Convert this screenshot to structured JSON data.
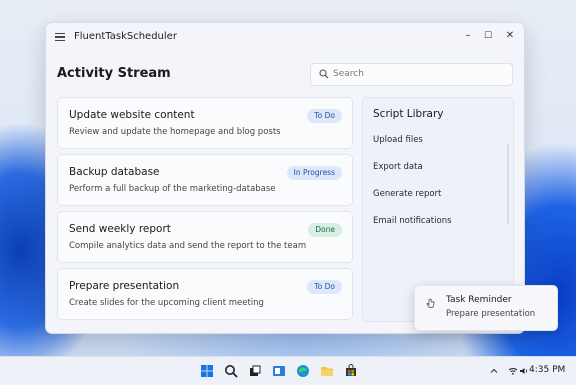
{
  "window": {
    "title": "FluentTaskScheduler",
    "controls": {
      "minimize": "–",
      "maximize": "☐",
      "close": "✕"
    }
  },
  "page": {
    "title": "Activity Stream"
  },
  "search": {
    "placeholder": "Search",
    "value": ""
  },
  "tasks": [
    {
      "title": "Update website content",
      "description": "Review and update the homepage and blog posts",
      "status": "To Do"
    },
    {
      "title": "Backup database",
      "description": "Perform a full backup of the marketing-database",
      "status": "In Progress"
    },
    {
      "title": "Send weekly report",
      "description": "Compile analytics data and send the report to the team",
      "status": "Done"
    },
    {
      "title": "Prepare presentation",
      "description": "Create slides for the upcoming client meeting",
      "status": "To Do"
    }
  ],
  "script_library": {
    "title": "Script Library",
    "items": [
      "Upload files",
      "Export data",
      "Generate report",
      "Email notifications"
    ]
  },
  "notification": {
    "title": "Task Reminder",
    "body": "Prepare presentation",
    "icon": "hand-pointer-icon"
  },
  "taskbar": {
    "icons": [
      "windows-start-icon",
      "search-icon",
      "task-view-icon",
      "widgets-icon",
      "edge-browser-icon",
      "file-explorer-icon",
      "store-icon"
    ],
    "tray": {
      "icons": [
        "chevron-up-icon",
        "wifi-icon",
        "volume-icon"
      ],
      "time": "4:35 PM"
    }
  },
  "colors": {
    "accent": "#1f4fa8",
    "done": "#1c6b44",
    "windows_blue": "#0b5cd5"
  }
}
